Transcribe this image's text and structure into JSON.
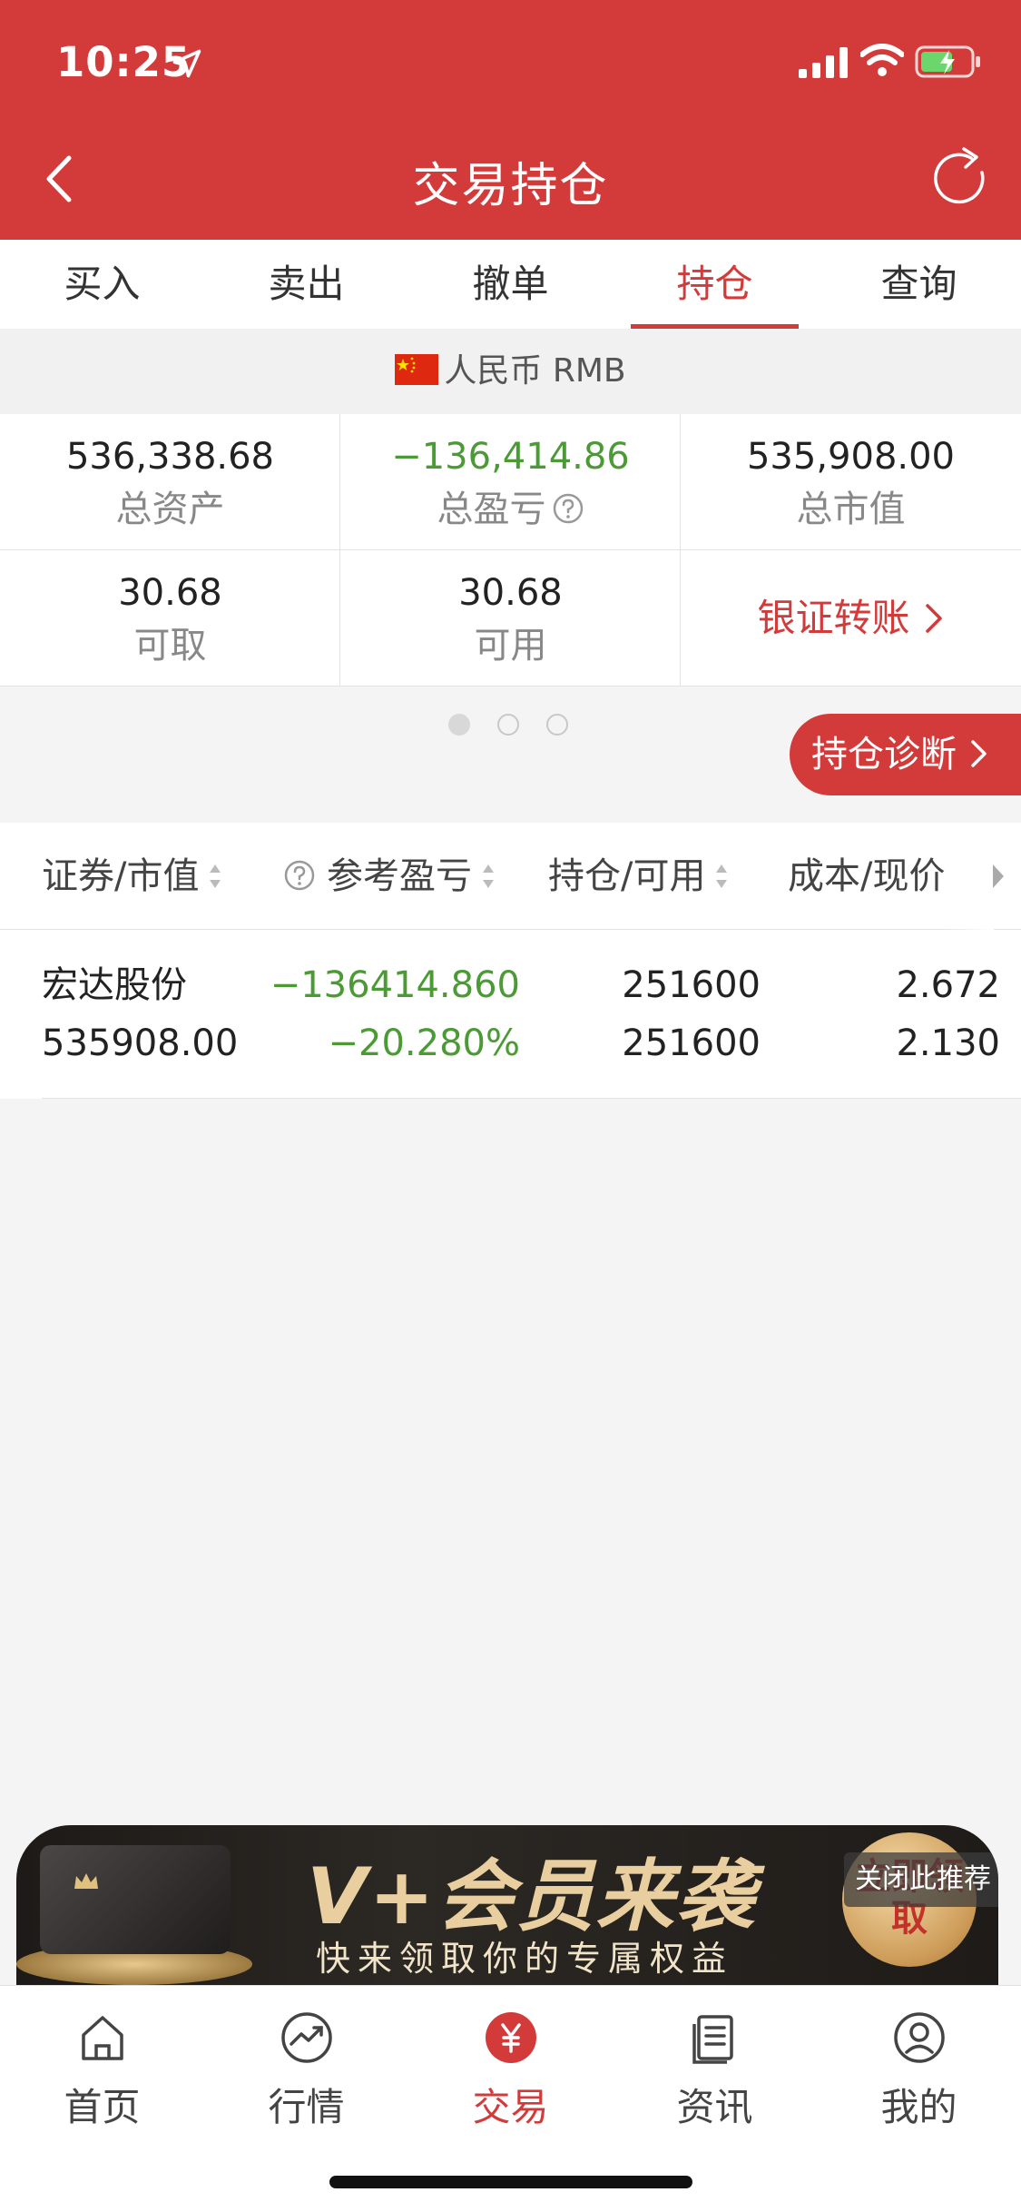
{
  "status": {
    "time": "10:25"
  },
  "header": {
    "title": "交易持仓"
  },
  "tabs": [
    "买入",
    "卖出",
    "撤单",
    "持仓",
    "查询"
  ],
  "active_tab": "持仓",
  "currency": {
    "label": "人民币 RMB"
  },
  "summary": {
    "total_assets": {
      "value": "536,338.68",
      "label": "总资产"
    },
    "total_pl": {
      "value": "−136,414.86",
      "label": "总盈亏"
    },
    "market_value": {
      "value": "535,908.00",
      "label": "总市值"
    },
    "withdrawable": {
      "value": "30.68",
      "label": "可取"
    },
    "available": {
      "value": "30.68",
      "label": "可用"
    },
    "bank_transfer": "银证转账"
  },
  "pager": {
    "total": 3,
    "current": 1
  },
  "diagnose_label": "持仓诊断",
  "table": {
    "headers": [
      "证券/市值",
      "参考盈亏",
      "持仓/可用",
      "成本/现价"
    ],
    "rows": [
      {
        "name": "宏达股份",
        "market_value": "535908.00",
        "pl": "−136414.860",
        "pl_pct": "−20.280%",
        "position": "251600",
        "available": "251600",
        "cost": "2.672",
        "price": "2.130"
      }
    ]
  },
  "banner": {
    "title": "V+会员来袭",
    "subtitle": "快来领取你的专属权益",
    "claim": "立即领取",
    "close_recommend": "关闭此推荐"
  },
  "tabbar": [
    "首页",
    "行情",
    "交易",
    "资讯",
    "我的"
  ],
  "tabbar_active": "交易",
  "colors": {
    "brand_red": "#d33b3b",
    "gain_green": "#4b9a35"
  }
}
